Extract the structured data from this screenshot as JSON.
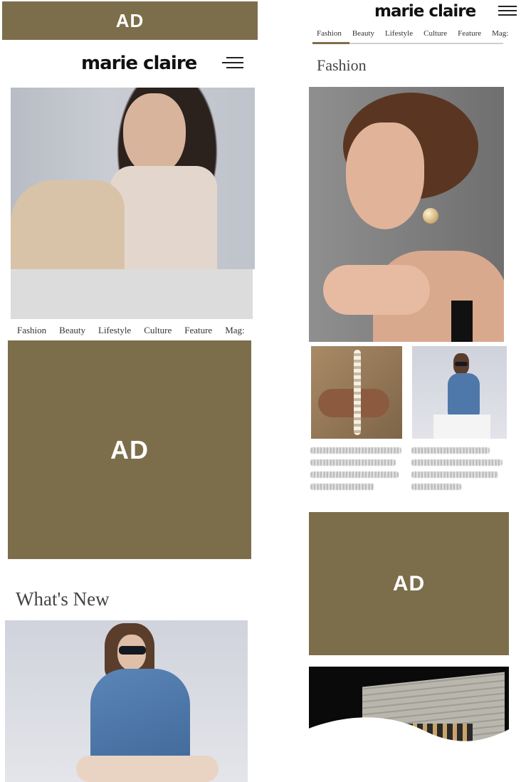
{
  "left": {
    "top_ad": "AD",
    "header": {
      "logo": "marie claire",
      "menu_icon": "hamburger-menu-icon"
    },
    "nav": {
      "tabs": [
        "Fashion",
        "Beauty",
        "Lifestyle",
        "Culture",
        "Feature",
        "Mag:"
      ]
    },
    "mid_ad": "AD",
    "section_title": "What's New"
  },
  "right": {
    "header": {
      "logo": "marie claire",
      "menu_icon": "hamburger-menu-icon"
    },
    "nav": {
      "tabs": [
        "Fashion",
        "Beauty",
        "Lifestyle",
        "Culture",
        "Feature",
        "Mag:"
      ],
      "active": "Fashion"
    },
    "section_title": "Fashion",
    "ad": "AD"
  },
  "colors": {
    "ad_background": "#7d6e4b",
    "ad_text": "#ffffff",
    "accent_underline": "#7d6e4b"
  }
}
